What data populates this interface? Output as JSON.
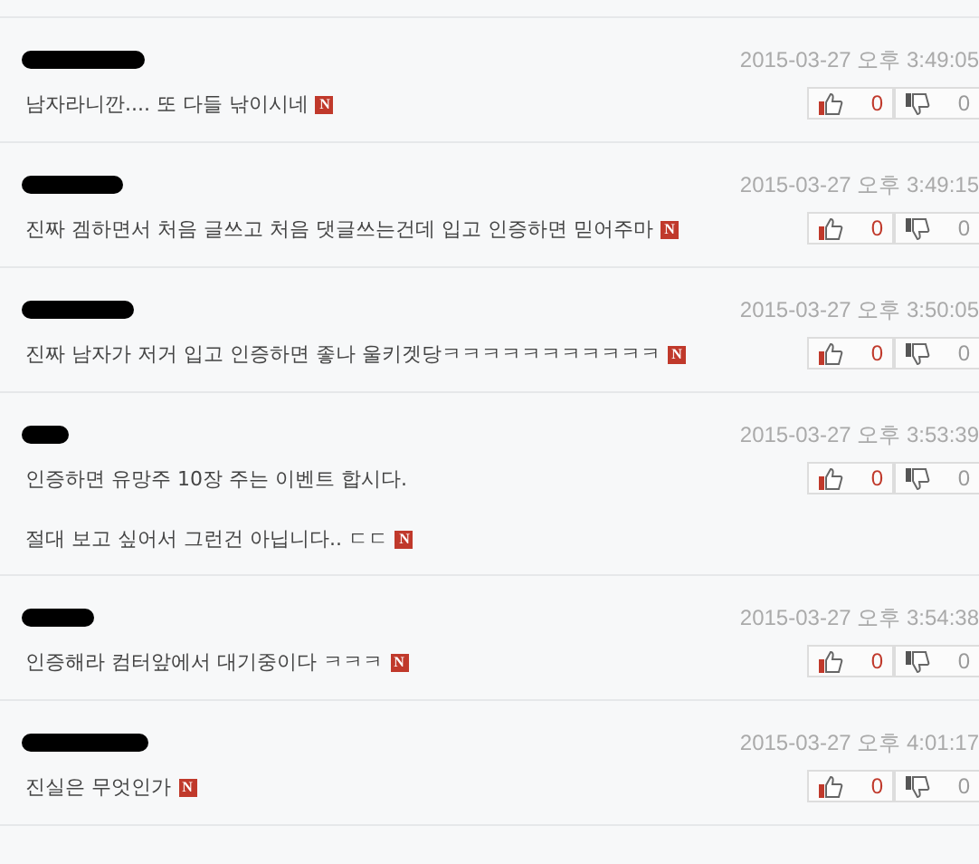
{
  "comments": [
    {
      "lines": [
        "남자라니깐.... 또 다들 낚이시네"
      ],
      "badge": "N",
      "time": "2015-03-27 오후 3:49:05",
      "likes": "0",
      "dislikes": "0"
    },
    {
      "lines": [
        "진짜 겜하면서 처음 글쓰고 처음 댓글쓰는건데 입고 인증하면 믿어주마"
      ],
      "badge": "N",
      "time": "2015-03-27 오후 3:49:15",
      "likes": "0",
      "dislikes": "0"
    },
    {
      "lines": [
        "진짜 남자가 저거 입고 인증하면 좋나 울키겟당ㅋㅋㅋㅋㅋㅋㅋㅋㅋㅋㅋ"
      ],
      "badge": "N",
      "time": "2015-03-27 오후 3:50:05",
      "likes": "0",
      "dislikes": "0"
    },
    {
      "lines": [
        "인증하면 유망주 10장 주는 이벤트 합시다.",
        "절대 보고 싶어서 그런건 아닙니다.. ㄷㄷ"
      ],
      "badge": "N",
      "time": "2015-03-27 오후 3:53:39",
      "likes": "0",
      "dislikes": "0"
    },
    {
      "lines": [
        "인증해라 컴터앞에서 대기중이다 ㅋㅋㅋ"
      ],
      "badge": "N",
      "time": "2015-03-27 오후 3:54:38",
      "likes": "0",
      "dislikes": "0"
    },
    {
      "lines": [
        "진실은 무엇인가"
      ],
      "badge": "N",
      "time": "2015-03-27 오후 4:01:17",
      "likes": "0",
      "dislikes": "0"
    }
  ]
}
